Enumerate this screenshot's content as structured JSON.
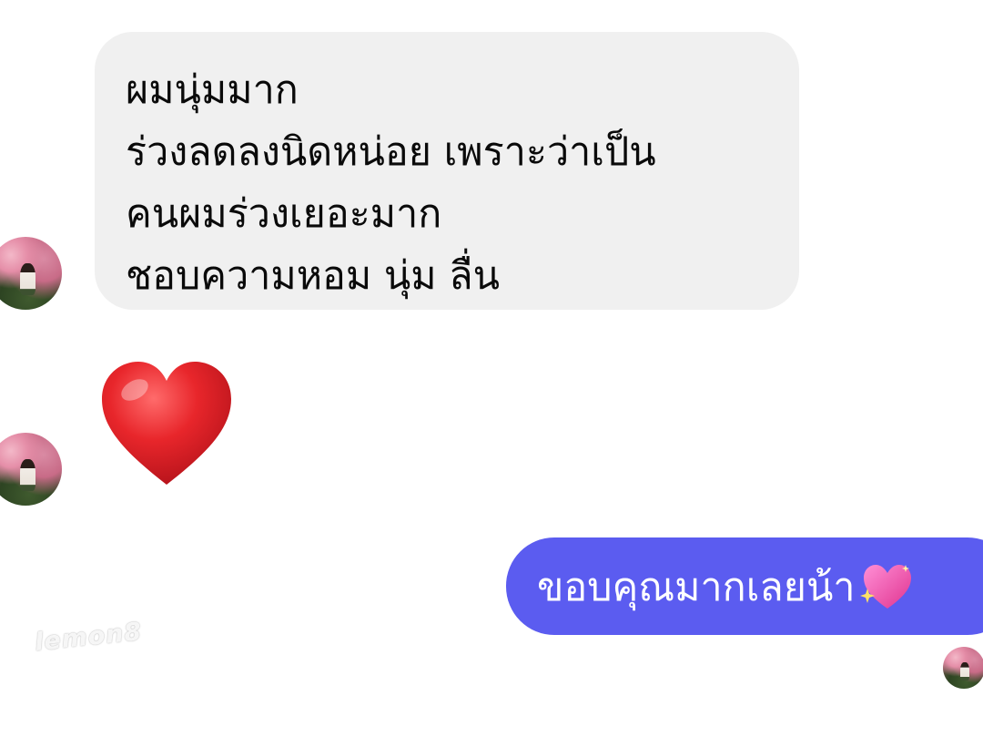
{
  "conversation": {
    "incoming_message": {
      "lines": [
        "ผมนุ่มมาก",
        "ร่วงลดลงนิดหน่อย เพราะว่าเป็น",
        "คนผมร่วงเยอะมาก",
        "ชอบความหอม นุ่ม ลื่น"
      ]
    },
    "reaction_emoji": "heart-icon",
    "outgoing_message": {
      "text": "ขอบคุณมากเลยน้า",
      "emoji": "sparkling-heart-icon"
    }
  },
  "watermark": "lemon8",
  "colors": {
    "incoming_bubble": "#f0f0f0",
    "outgoing_bubble": "#5b5cf0",
    "incoming_text": "#0a0a0a",
    "outgoing_text": "#ffffff",
    "heart": "#e0262b"
  }
}
